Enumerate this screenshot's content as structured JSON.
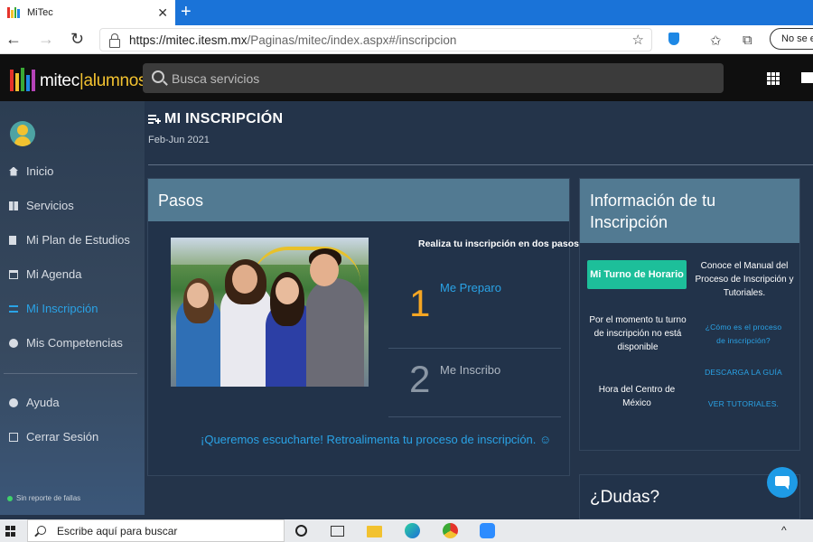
{
  "browser": {
    "tab_title": "MiTec",
    "url_host": "https://mitec.itesm.mx",
    "url_path": "/Paginas/mitec/index.aspx#/inscripcion",
    "profile_label": "No se est"
  },
  "header": {
    "brand_prefix": "mitec",
    "brand_suffix": "|alumnos",
    "search_placeholder": "Busca servicios"
  },
  "sidebar": {
    "items": [
      {
        "label": "Inicio",
        "icon": "home-icon"
      },
      {
        "label": "Servicios",
        "icon": "grid-icon"
      },
      {
        "label": "Mi Plan de Estudios",
        "icon": "document-icon"
      },
      {
        "label": "Mi Agenda",
        "icon": "calendar-icon"
      },
      {
        "label": "Mi Inscripción",
        "icon": "playlist-add-icon",
        "active": true
      },
      {
        "label": "Mis Competencias",
        "icon": "badge-icon"
      }
    ],
    "secondary": [
      {
        "label": "Ayuda",
        "icon": "help-icon"
      },
      {
        "label": "Cerrar Sesión",
        "icon": "logout-icon"
      }
    ],
    "status": "Sin reporte de fallas"
  },
  "main": {
    "title": "MI INSCRIPCIÓN",
    "period": "Feb-Jun 2021",
    "steps": {
      "title": "Pasos",
      "intro": "Realiza tu inscripción en dos pasos:",
      "items": [
        {
          "number": "1",
          "label": "Me Preparo"
        },
        {
          "number": "2",
          "label": "Me Inscribo"
        }
      ],
      "feedback": "¡Queremos escucharte! Retroalimenta tu proceso de inscripción. ☺"
    },
    "info": {
      "title_line1": "Información de tu",
      "title_line2": "Inscripción",
      "turno_button": "Mi Turno de Horario",
      "manual_text": "Conoce el Manual del Proceso de Inscripción y Tutoriales.",
      "turno_status": "Por el momento tu turno de inscripción no está disponible",
      "link_process": "¿Cómo es el proceso de inscripción?",
      "link_guide": "DESCARGA LA GUÍA",
      "hora_label": "Hora del Centro de México",
      "link_tutorials": "VER TUTORIALES."
    },
    "dudas": {
      "title": "¿Dudas?"
    }
  },
  "taskbar": {
    "search_placeholder": "Escribe aquí para buscar"
  },
  "colors": {
    "accent": "#2aa3e6",
    "step_active": "#f5a623",
    "turno_button": "#1dbf9a",
    "card_header": "#527a92"
  }
}
